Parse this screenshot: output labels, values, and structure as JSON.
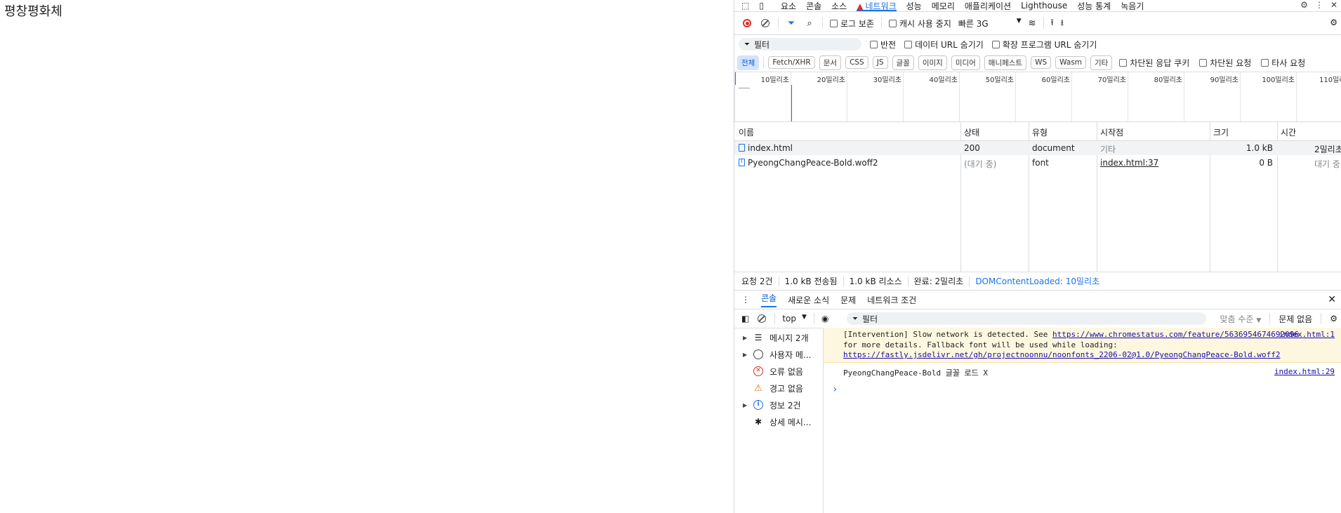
{
  "page": {
    "text": "평창평화체"
  },
  "devtools": {
    "top_tabs": [
      "요소",
      "콘솔",
      "소스",
      "네트워크",
      "성능",
      "메모리",
      "애플리케이션",
      "Lighthouse",
      "성능 통계",
      "녹음기"
    ],
    "toolbar": {
      "preserve_log": "로그 보존",
      "disable_cache": "캐시 사용 중지",
      "throttle": "빠른 3G"
    },
    "filter": {
      "placeholder": "필터",
      "invert": "반전",
      "hide_data_urls": "데이터 URL 숨기기",
      "hide_ext_urls": "확장 프로그램 URL 숨기기"
    },
    "types": [
      "전체",
      "Fetch/XHR",
      "문서",
      "CSS",
      "JS",
      "글꼴",
      "이미지",
      "미디어",
      "매니페스트",
      "WS",
      "Wasm",
      "기타"
    ],
    "type_checks": [
      "차단된 응답 쿠키",
      "차단된 요청",
      "타사 요청"
    ],
    "timeline_ticks": [
      "10밀리초",
      "20밀리초",
      "30밀리초",
      "40밀리초",
      "50밀리초",
      "60밀리초",
      "70밀리초",
      "80밀리초",
      "90밀리초",
      "100밀리초",
      "110밀리초"
    ],
    "columns": [
      "이름",
      "상태",
      "유형",
      "시작점",
      "크기",
      "시간"
    ],
    "rows": [
      {
        "name": "index.html",
        "status": "200",
        "type": "document",
        "initiator": "기타",
        "size": "1.0 kB",
        "time": "2밀리초"
      },
      {
        "name": "PyeongChangPeace-Bold.woff2",
        "status": "(대기 중)",
        "type": "font",
        "initiator": "index.html:37",
        "size": "0 B",
        "time": "대기 중"
      }
    ],
    "status": {
      "requests": "요청 2건",
      "transferred": "1.0 kB 전송됨",
      "resources": "1.0 kB 리소스",
      "finish": "완료: 2밀리초",
      "dcl": "DOMContentLoaded: 10밀리초"
    },
    "drawer_tabs": [
      "콘솔",
      "새로운 소식",
      "문제",
      "네트워크 조건"
    ],
    "console_toolbar": {
      "context": "top",
      "filter_placeholder": "필터",
      "levels": "맞춤 수준",
      "issues": "문제 없음"
    },
    "sidebar": [
      {
        "label": "메시지 2개",
        "icon": "list-icon",
        "expandable": true
      },
      {
        "label": "사용자 메...",
        "icon": "user-icon",
        "expandable": true
      },
      {
        "label": "오류 없음",
        "icon": "error-icon",
        "expandable": false
      },
      {
        "label": "경고 없음",
        "icon": "warning-icon",
        "expandable": false
      },
      {
        "label": "정보 2건",
        "icon": "info-icon",
        "expandable": true
      },
      {
        "label": "상세 메시...",
        "icon": "bug-icon",
        "expandable": false
      }
    ],
    "messages": {
      "warn_line1": "[Intervention] Slow network is detected. See ",
      "warn_link1": "https://www.chromestatus.com/feature/5636954674692096",
      "warn_line2": "for more details. Fallback font will be used while loading:",
      "warn_link2": "https://fastly.jsdelivr.net/gh/projectnoonnu/noonfonts_2206-02@1.0/PyeongChangPeace-Bold.woff2",
      "warn_src": "index.html:1",
      "log_text": "PyeongChangPeace-Bold 글꼴 로드 X",
      "log_src": "index.html:29"
    }
  }
}
